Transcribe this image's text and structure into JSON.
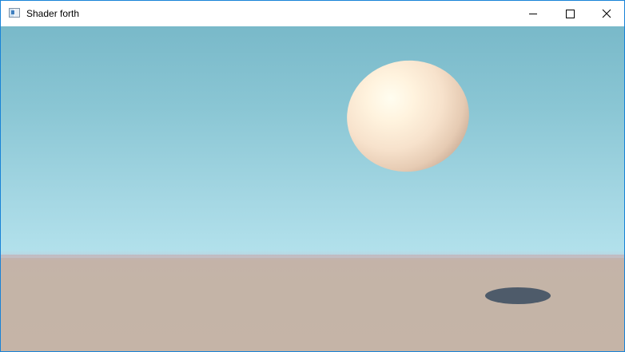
{
  "window": {
    "title": "Shader forth",
    "icons": {
      "app": "app-window-icon",
      "minimize": "minimize-icon",
      "maximize": "maximize-icon",
      "close": "close-icon"
    }
  },
  "scene": {
    "sky_colors": [
      "#79b9c9",
      "#bde8f2"
    ],
    "ground_color": "#c5b4a7",
    "sphere_color": "#f7e2cc",
    "shadow_color": "#4e5b6a"
  }
}
